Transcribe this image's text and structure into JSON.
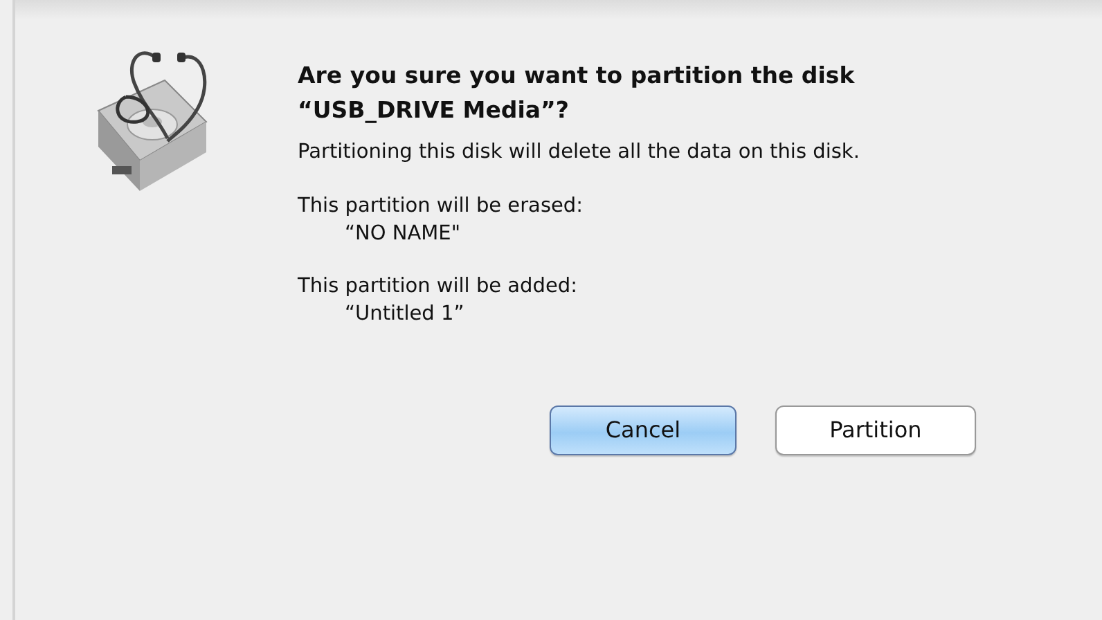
{
  "alert": {
    "title": "Are you sure you want to partition the disk “USB_DRIVE Media”?",
    "message": "Partitioning this disk will delete all the data on this disk.",
    "sections": [
      {
        "label": "This partition will be erased:",
        "value": "“NO NAME\""
      },
      {
        "label": "This partition will be added:",
        "value": "“Untitled 1”"
      }
    ],
    "buttons": [
      {
        "label": "Cancel",
        "default": true
      },
      {
        "label": "Partition",
        "default": false
      }
    ]
  }
}
